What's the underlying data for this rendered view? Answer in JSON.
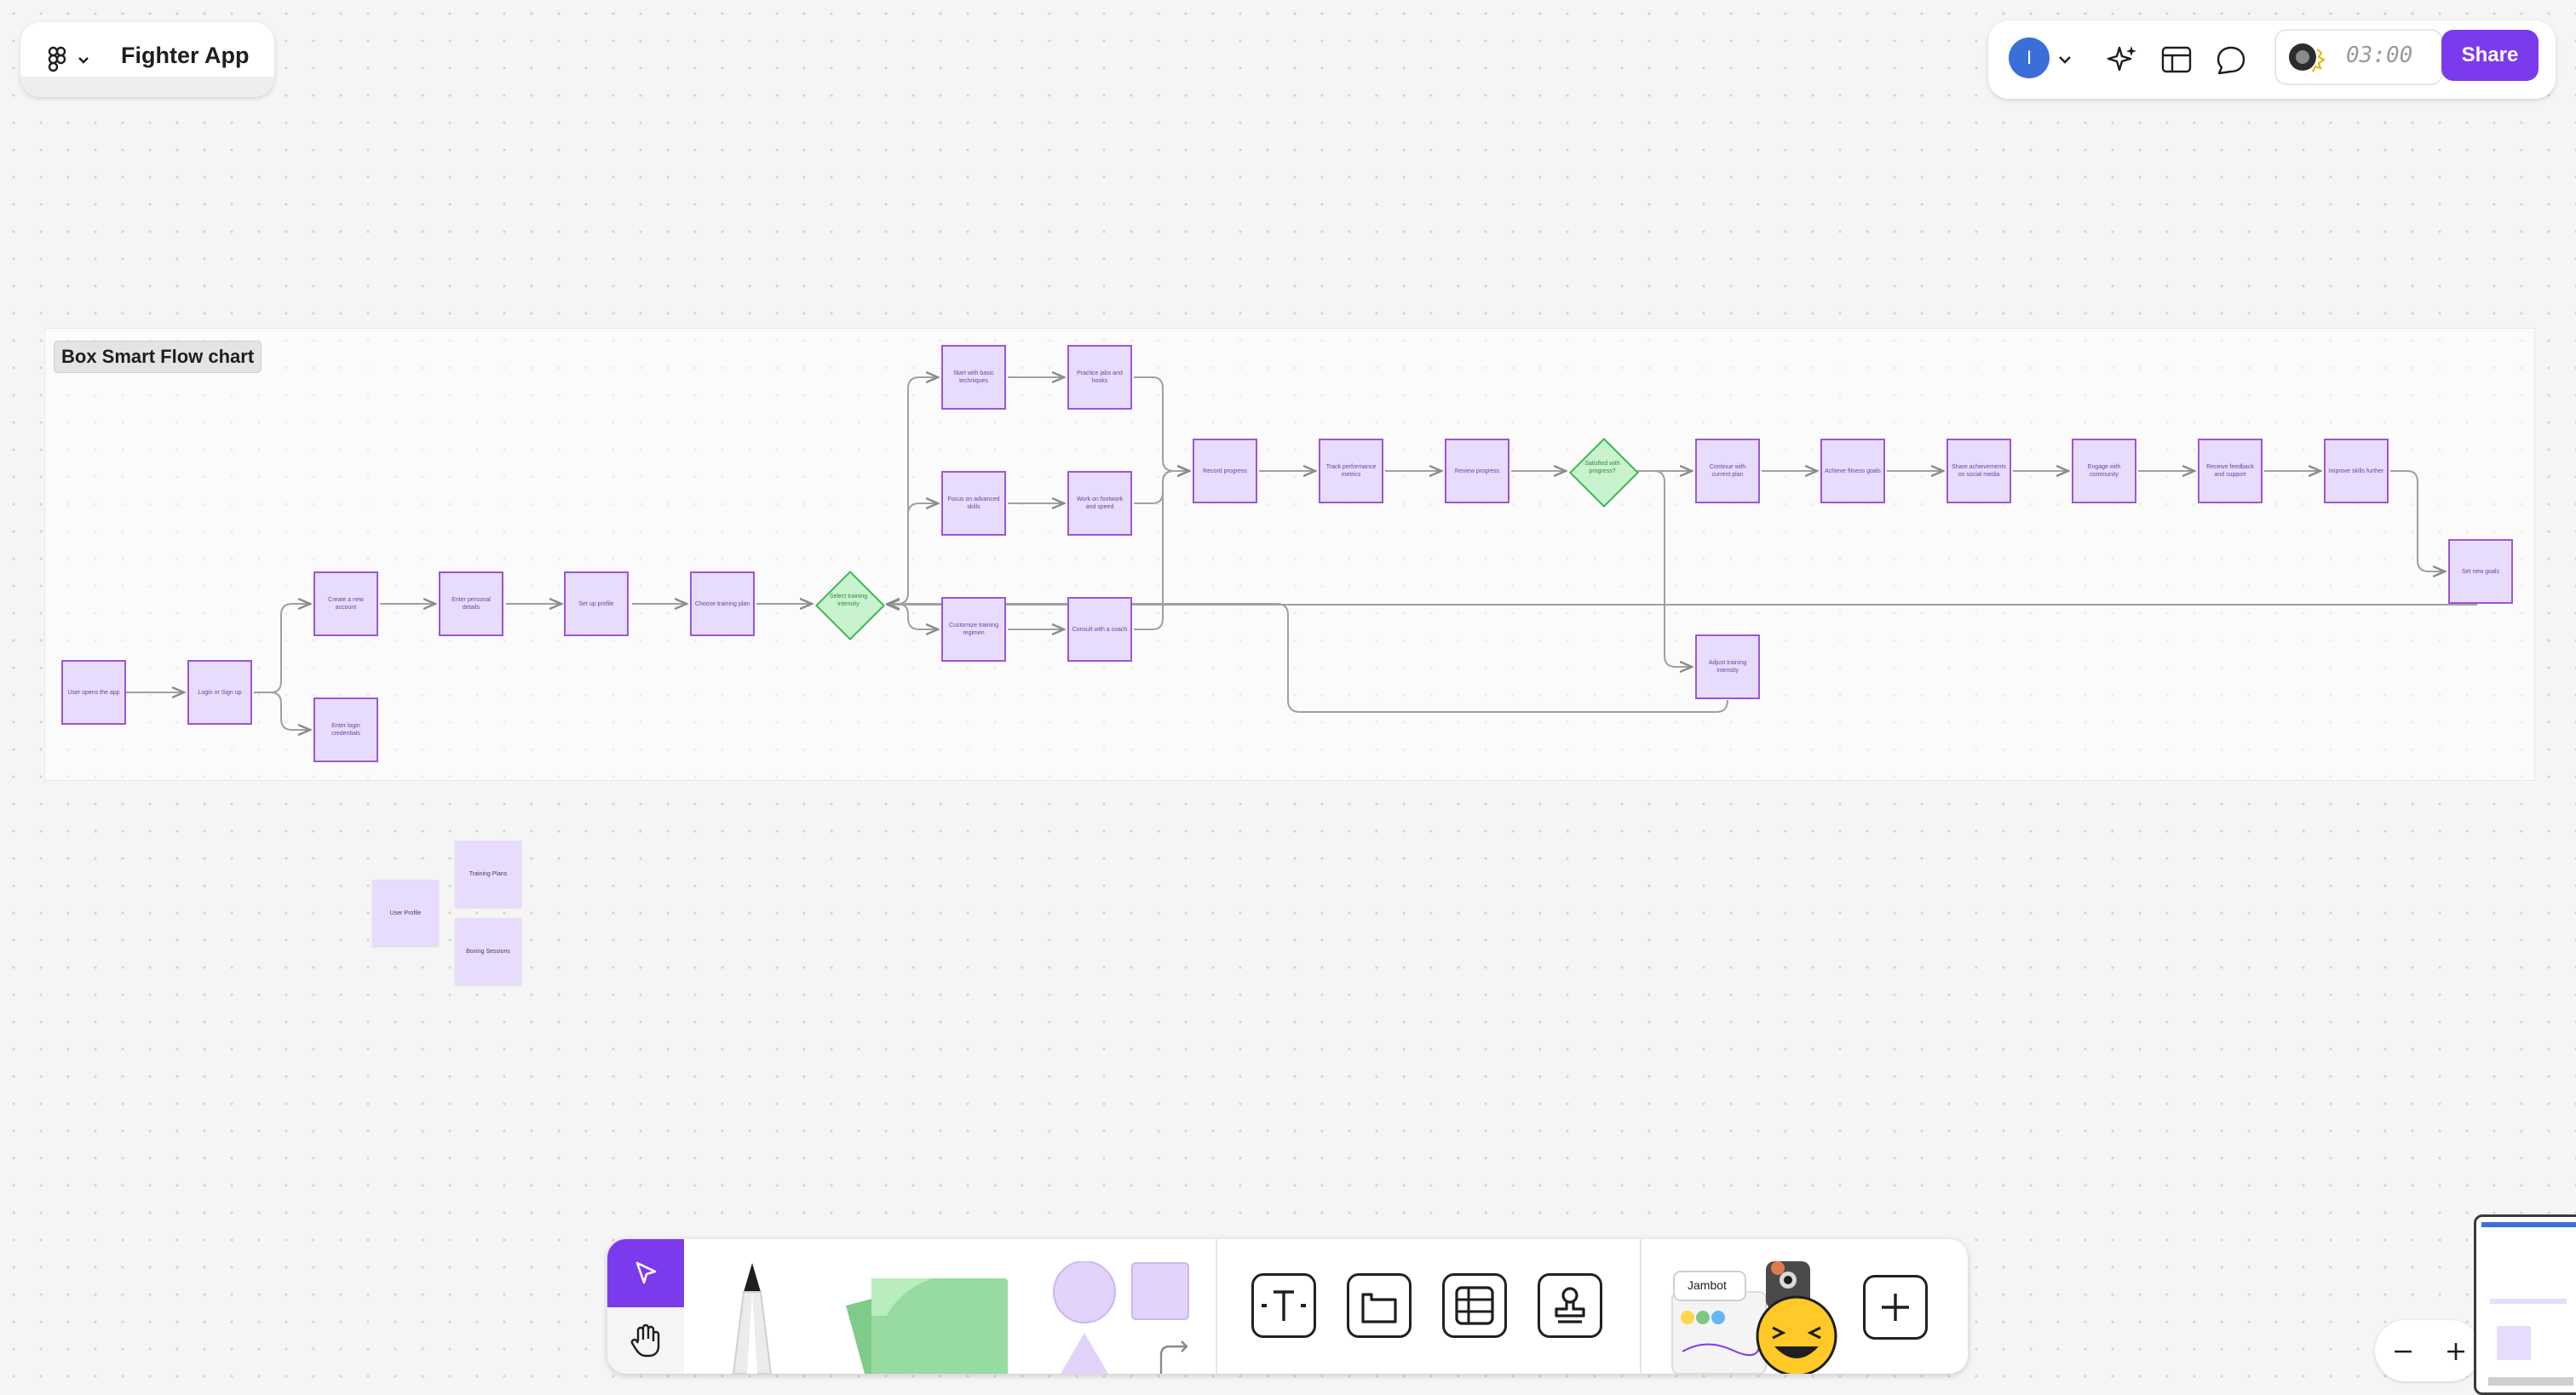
{
  "app": {
    "file_title": "Fighter App",
    "menu_icon": "figma-logo-icon"
  },
  "header": {
    "avatar_initial": "I",
    "timer": "03:00",
    "share_label": "Share",
    "icons": [
      "ai-sparkle-icon",
      "layout-icon",
      "comment-icon"
    ]
  },
  "section": {
    "title": "Box Smart Flow chart"
  },
  "flow": {
    "nodes": [
      {
        "id": "n1",
        "text": "User opens the app"
      },
      {
        "id": "n2",
        "text": "Login or Sign up"
      },
      {
        "id": "n3",
        "text": "Create a new account"
      },
      {
        "id": "n4",
        "text": "Enter login credentials"
      },
      {
        "id": "n5",
        "text": "Enter personal details"
      },
      {
        "id": "n6",
        "text": "Set up profile"
      },
      {
        "id": "n7",
        "text": "Choose training plan"
      },
      {
        "id": "d1",
        "text": "Select training intensity"
      },
      {
        "id": "n8",
        "text": "Start with basic techniques"
      },
      {
        "id": "n9",
        "text": "Practice jabs and hooks"
      },
      {
        "id": "n10",
        "text": "Focus on advanced skills"
      },
      {
        "id": "n11",
        "text": "Work on footwork and speed"
      },
      {
        "id": "n12",
        "text": "Customize training regimen"
      },
      {
        "id": "n13",
        "text": "Consult with a coach"
      },
      {
        "id": "n14",
        "text": "Record progress"
      },
      {
        "id": "n15",
        "text": "Track performance metrics"
      },
      {
        "id": "n16",
        "text": "Review progress"
      },
      {
        "id": "d2",
        "text": "Satisfied with progress?"
      },
      {
        "id": "n17",
        "text": "Continue with current plan"
      },
      {
        "id": "n18",
        "text": "Achieve fitness goals"
      },
      {
        "id": "n19",
        "text": "Share achievements on social media"
      },
      {
        "id": "n20",
        "text": "Engage with community"
      },
      {
        "id": "n21",
        "text": "Receive feedback and support"
      },
      {
        "id": "n22",
        "text": "Improve skills further"
      },
      {
        "id": "n23",
        "text": "Set new goals"
      },
      {
        "id": "n24",
        "text": "Adjust training intensity"
      }
    ]
  },
  "stickies": [
    {
      "id": "s1",
      "text": "User Profile"
    },
    {
      "id": "s2",
      "text": "Training Plans"
    },
    {
      "id": "s3",
      "text": "Boxing Sessions"
    }
  ],
  "toolbar": {
    "tools": [
      "move-cursor-icon",
      "hand-icon",
      "marker-icon",
      "sticky-note-icon",
      "shape-icon",
      "connector-icon",
      "text-icon",
      "section-icon",
      "table-icon",
      "stamp-icon",
      "widgets-icon",
      "add-icon"
    ],
    "jambot_label": "Jambot"
  },
  "colors": {
    "accent": "#7c3aed",
    "node_fill": "#e7dcfb",
    "node_border": "#9b56d8",
    "decision_fill": "#c9f2cf",
    "decision_border": "#41b855"
  }
}
